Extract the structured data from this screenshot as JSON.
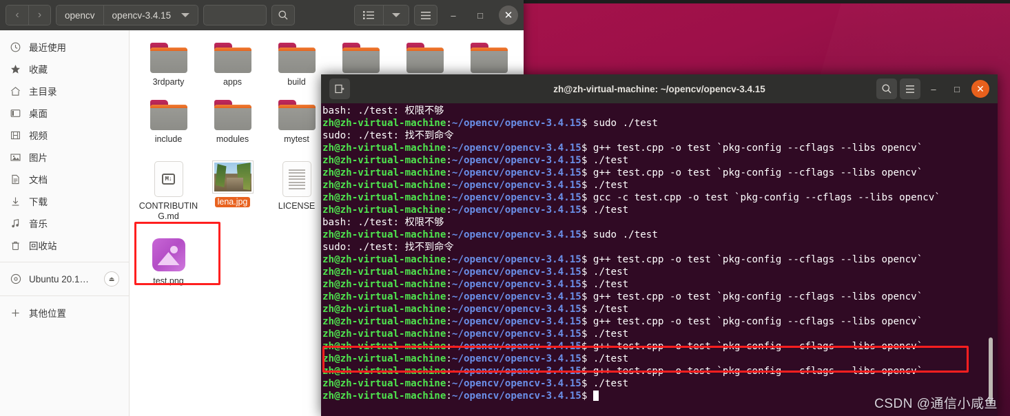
{
  "file_manager": {
    "nav": {
      "back": "‹",
      "forward": "›"
    },
    "breadcrumbs": [
      "opencv",
      "opencv-3.4.15"
    ],
    "path_entry_value": "",
    "search_icon": "search-icon",
    "view_list_icon": "list-view-icon",
    "view_dropdown_icon": "chevron-down-icon",
    "menu_icon": "hamburger-menu-icon",
    "window_controls": {
      "minimize": "–",
      "maximize": "□",
      "close": "✕"
    },
    "sidebar": [
      {
        "label": "最近使用",
        "icon": "clock-icon"
      },
      {
        "label": "收藏",
        "icon": "star-icon"
      },
      {
        "label": "主目录",
        "icon": "home-icon"
      },
      {
        "label": "桌面",
        "icon": "desktop-icon"
      },
      {
        "label": "视频",
        "icon": "video-icon"
      },
      {
        "label": "图片",
        "icon": "pictures-icon"
      },
      {
        "label": "文档",
        "icon": "documents-icon"
      },
      {
        "label": "下载",
        "icon": "download-icon"
      },
      {
        "label": "音乐",
        "icon": "music-icon"
      },
      {
        "label": "回收站",
        "icon": "trash-icon"
      }
    ],
    "sidebar_device": {
      "label": "Ubuntu 20.1…",
      "icon": "disc-icon",
      "eject": "⏏"
    },
    "sidebar_other": {
      "label": "其他位置",
      "icon": "plus-icon"
    },
    "files": [
      {
        "name": "3rdparty",
        "type": "folder",
        "selected": false
      },
      {
        "name": "apps",
        "type": "folder",
        "selected": false
      },
      {
        "name": "build",
        "type": "folder",
        "selected": false
      },
      {
        "name": "",
        "type": "folder",
        "selected": false
      },
      {
        "name": "",
        "type": "folder",
        "selected": false
      },
      {
        "name": "",
        "type": "folder",
        "selected": false
      },
      {
        "name": "include",
        "type": "folder",
        "selected": false
      },
      {
        "name": "modules",
        "type": "folder",
        "selected": false
      },
      {
        "name": "mytest",
        "type": "folder",
        "selected": false
      },
      {
        "name": "CONTRIBUTING.md",
        "type": "markdown",
        "selected": false,
        "badge": "M↓"
      },
      {
        "name": "lena.jpg",
        "type": "image",
        "selected": true
      },
      {
        "name": "LICENSE",
        "type": "text",
        "selected": false
      },
      {
        "name": "test.png",
        "type": "png",
        "selected": false,
        "highlighted": true
      }
    ]
  },
  "terminal": {
    "title": "zh@zh-virtual-machine: ~/opencv/opencv-3.4.15",
    "new_tab_icon": "new-tab-icon",
    "search_icon": "search-icon",
    "menu_icon": "hamburger-menu-icon",
    "window_controls": {
      "minimize": "–",
      "maximize": "□",
      "close": "✕"
    },
    "prompt": {
      "user": "zh@zh-virtual-machine",
      "colon": ":",
      "path": "~/opencv/opencv-3.4.15",
      "dollar": "$"
    },
    "lines": [
      {
        "type": "output",
        "text": "bash: ./test: 权限不够"
      },
      {
        "type": "prompt",
        "cmd": " sudo ./test"
      },
      {
        "type": "output",
        "text": "sudo: ./test: 找不到命令"
      },
      {
        "type": "prompt",
        "cmd": " g++ test.cpp -o test `pkg-config --cflags --libs opencv`"
      },
      {
        "type": "prompt",
        "cmd": " ./test"
      },
      {
        "type": "prompt",
        "cmd": " g++ test.cpp -o test `pkg-config --cflags --libs opencv`"
      },
      {
        "type": "prompt",
        "cmd": " ./test"
      },
      {
        "type": "prompt",
        "cmd": " gcc -c test.cpp -o test `pkg-config --cflags --libs opencv`"
      },
      {
        "type": "prompt",
        "cmd": " ./test"
      },
      {
        "type": "output",
        "text": "bash: ./test: 权限不够"
      },
      {
        "type": "prompt",
        "cmd": " sudo ./test"
      },
      {
        "type": "output",
        "text": "sudo: ./test: 找不到命令"
      },
      {
        "type": "prompt",
        "cmd": " g++ test.cpp -o test `pkg-config --cflags --libs opencv`"
      },
      {
        "type": "prompt",
        "cmd": " ./test"
      },
      {
        "type": "prompt",
        "cmd": " ./test"
      },
      {
        "type": "prompt",
        "cmd": " g++ test.cpp -o test `pkg-config --cflags --libs opencv`"
      },
      {
        "type": "prompt",
        "cmd": " ./test"
      },
      {
        "type": "prompt",
        "cmd": " g++ test.cpp -o test `pkg-config --cflags --libs opencv`"
      },
      {
        "type": "prompt",
        "cmd": " ./test"
      },
      {
        "type": "prompt",
        "cmd": " g++ test.cpp -o test `pkg-config --cflags --libs opencv`"
      },
      {
        "type": "prompt",
        "cmd": " ./test"
      },
      {
        "type": "prompt",
        "cmd": " g++ test.cpp -o test `pkg-config --cflags --libs opencv`"
      },
      {
        "type": "prompt",
        "cmd": " ./test"
      },
      {
        "type": "prompt",
        "cmd": " ",
        "cursor": true
      }
    ]
  },
  "watermark": "CSDN @通信小咸鱼",
  "colors": {
    "terminal_bg": "#300a24",
    "prompt_user": "#4ee44e",
    "prompt_path": "#6a8fe8",
    "highlight_box": "#ff1f1f",
    "selection_orange": "#e8621f",
    "header_bg": "#3b3b39",
    "wallpaper": "#a8134a"
  }
}
